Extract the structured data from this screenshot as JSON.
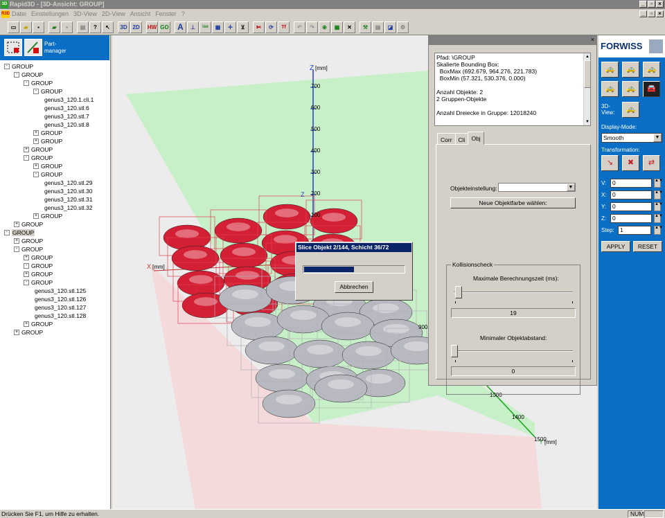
{
  "window": {
    "title": "Rapid3D - [3D-Ansicht: GROUP]",
    "app_icon": "3D"
  },
  "menu": {
    "logo": "R3D",
    "items": [
      "Datei",
      "Einstellungen",
      "3D-View",
      "2D-View",
      "Ansicht",
      "Fenster",
      "?"
    ]
  },
  "toolbar": {
    "labels": [
      "3D",
      "2D",
      "HW",
      "GO",
      "A",
      "iso",
      "Tf"
    ]
  },
  "partmanager": {
    "label": "Part-\nmanager"
  },
  "tree": [
    {
      "label": "GROUP",
      "level": 0,
      "box": "-"
    },
    {
      "label": "GROUP",
      "level": 1,
      "box": "-"
    },
    {
      "label": "GROUP",
      "level": 2,
      "box": "-"
    },
    {
      "label": "GROUP",
      "level": 3,
      "box": "-"
    },
    {
      "label": "genus3_120.1.cli.1",
      "level": 4,
      "box": ""
    },
    {
      "label": "genus3_120.stl.6",
      "level": 4,
      "box": ""
    },
    {
      "label": "genus3_120.stl.7",
      "level": 4,
      "box": ""
    },
    {
      "label": "genus3_120.stl.8",
      "level": 4,
      "box": ""
    },
    {
      "label": "GROUP",
      "level": 3,
      "box": "+"
    },
    {
      "label": "GROUP",
      "level": 3,
      "box": "+"
    },
    {
      "label": "GROUP",
      "level": 2,
      "box": "+"
    },
    {
      "label": "GROUP",
      "level": 2,
      "box": "-"
    },
    {
      "label": "GROUP",
      "level": 3,
      "box": "+"
    },
    {
      "label": "GROUP",
      "level": 3,
      "box": "-"
    },
    {
      "label": "genus3_120.stl.29",
      "level": 4,
      "box": ""
    },
    {
      "label": "genus3_120.stl.30",
      "level": 4,
      "box": ""
    },
    {
      "label": "genus3_120.stl.31",
      "level": 4,
      "box": ""
    },
    {
      "label": "genus3_120.stl.32",
      "level": 4,
      "box": ""
    },
    {
      "label": "GROUP",
      "level": 3,
      "box": "+"
    },
    {
      "label": "GROUP",
      "level": 1,
      "box": "+"
    },
    {
      "label": "GROUP",
      "level": 0,
      "box": "-",
      "selected": true
    },
    {
      "label": "GROUP",
      "level": 1,
      "box": "+"
    },
    {
      "label": "GROUP",
      "level": 1,
      "box": "-"
    },
    {
      "label": "GROUP",
      "level": 2,
      "box": "+"
    },
    {
      "label": "GROUP",
      "level": 2,
      "box": "-"
    },
    {
      "label": "GROUP",
      "level": 2,
      "box": "+"
    },
    {
      "label": "GROUP",
      "level": 2,
      "box": "-"
    },
    {
      "label": "genus3_120.stl.125",
      "level": 3,
      "box": ""
    },
    {
      "label": "genus3_120.stl.126",
      "level": 3,
      "box": ""
    },
    {
      "label": "genus3_120.stl.127",
      "level": 3,
      "box": ""
    },
    {
      "label": "genus3_120.stl.128",
      "level": 3,
      "box": ""
    },
    {
      "label": "GROUP",
      "level": 2,
      "box": "+"
    },
    {
      "label": "GROUP",
      "level": 1,
      "box": "+"
    }
  ],
  "viewport": {
    "z_label": "Z",
    "z_unit": "[mm]",
    "x_label": "X",
    "x_unit": "[mm]",
    "y_label": "Y",
    "y_unit": "[mm]",
    "z_ticks": [
      "700",
      "600",
      "500",
      "400",
      "300",
      "200",
      "100"
    ],
    "y_ticks": [
      "1300",
      "1400",
      "1500"
    ],
    "x_tick": "900"
  },
  "info": {
    "lines": [
      "Pfad: \\GROUP",
      "Skalierte Bounding Box:",
      "  BoxMax (692.679, 964.276, 221.783)",
      "  BoxMin (57.321, 530.376, 0.000)",
      "",
      "Anzahl Objekte: 2",
      "2 Gruppen-Objekte",
      "",
      "Anzahl Dreiecke in Gruppe: 12018240"
    ]
  },
  "tabs": [
    "Corr",
    "Cli",
    "Obj"
  ],
  "obj": {
    "objekteinstellung_label": "Objekteinstellung:",
    "neue_farbe": "Neue Objektfarbe wählen:",
    "kollision_group": "Kollisionscheck",
    "max_zeit_label": "Maximale Berechnungszeit (ms):",
    "max_zeit_value": "19",
    "min_abstand_label": "Minimaler Objektabstand:",
    "min_abstand_value": "0"
  },
  "progress": {
    "title": "Slice Objekt 2/144, Schicht 36/72",
    "fraction": 0.5,
    "cancel": "Abbrechen"
  },
  "right": {
    "brand": "FORWISS",
    "view3d_label": "3D-\nView:",
    "display_mode_label": "Display-Mode:",
    "display_mode_value": "Smooth",
    "transformation_label": "Transformation:",
    "fields": [
      {
        "label": "V:",
        "value": "0"
      },
      {
        "label": "X:",
        "value": "0"
      },
      {
        "label": "Y:",
        "value": "0"
      },
      {
        "label": "Z:",
        "value": "0"
      },
      {
        "label": "Step:",
        "value": "1"
      }
    ],
    "apply": "APPLY",
    "reset": "RESET"
  },
  "status": {
    "text": "Drücken Sie F1, um Hilfe zu erhalten.",
    "num": "NUM"
  },
  "colors": {
    "accent_blue": "#0a6ec4",
    "red_parts": "#d42035",
    "grey_parts": "#b8b8c0",
    "plane_green": "#c8f0c8",
    "plane_pink": "#f4dada"
  }
}
